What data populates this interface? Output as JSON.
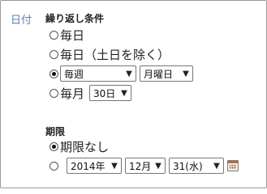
{
  "field_label": "日付",
  "repeat": {
    "title": "繰り返し条件",
    "options": [
      {
        "label": "毎日",
        "checked": false
      },
      {
        "label": "毎日（土日を除く）",
        "checked": false
      },
      {
        "label": "",
        "checked": true,
        "period_value": "毎週",
        "weekday_value": "月曜日"
      },
      {
        "label": "毎月",
        "checked": false,
        "day_value": "30日"
      }
    ]
  },
  "deadline": {
    "title": "期限",
    "options": [
      {
        "label": "期限なし",
        "checked": true
      },
      {
        "label": "",
        "checked": false,
        "year_value": "2014年",
        "month_value": "12月",
        "day_value": "31(水)"
      }
    ]
  },
  "icons": {
    "caret": "chevron-down-icon",
    "calendar": "calendar-icon"
  },
  "colors": {
    "field_label": "#5a7fb0",
    "border": "#9a9a9a"
  }
}
